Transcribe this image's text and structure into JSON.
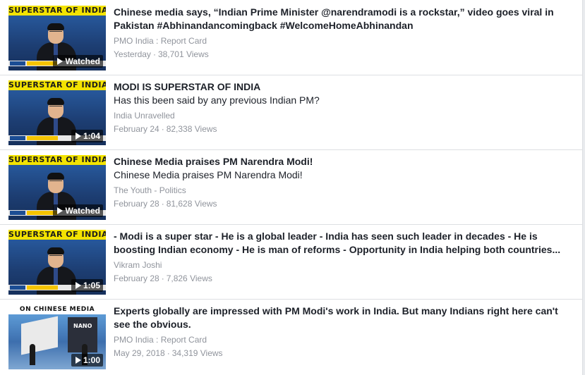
{
  "videos": [
    {
      "title": "Chinese media says, “Indian Prime Minister @narendramodi is a rockstar,” video goes viral in Pakistan #Abhinandancomingback #WelcomeHomeAbhinandan",
      "subtitle": "",
      "channel": "PMO India : Report Card",
      "date": "Yesterday",
      "views": "38,701 Views",
      "badge": "Watched",
      "thumb_banner": "SUPERSTAR OF INDIA"
    },
    {
      "title": "MODI IS SUPERSTAR OF INDIA",
      "subtitle": "Has this been said by any previous Indian PM?",
      "channel": "India Unravelled",
      "date": "February 24",
      "views": "82,338 Views",
      "badge": "1:04",
      "thumb_banner": "SUPERSTAR OF INDIA"
    },
    {
      "title": "Chinese Media praises PM Narendra Modi!",
      "subtitle": "Chinese Media praises PM Narendra Modi!",
      "channel": "The Youth - Politics",
      "date": "February 28",
      "views": "81,628 Views",
      "badge": "Watched",
      "thumb_banner": "SUPERSTAR OF INDIA"
    },
    {
      "title": "- Modi is a super star - He is a global leader - India has seen such leader in decades - He is boosting Indian economy - He is man of reforms - Opportunity in India helping both countries...",
      "subtitle": "",
      "channel": "Vikram Joshi",
      "date": "February 28",
      "views": "7,826 Views",
      "badge": "1:05",
      "thumb_banner": "SUPERSTAR OF INDIA"
    },
    {
      "title": "Experts globally are impressed with PM Modi's work in India. But many Indians right here can't see the obvious.",
      "subtitle": "",
      "channel": "PMO India : Report Card",
      "date": "May 29, 2018",
      "views": "34,319 Views",
      "badge": "1:00",
      "thumb_banner": "ON CHINESE MEDIA"
    }
  ],
  "separator": "·",
  "colors": {
    "title": "#1d2129",
    "meta": "#90949c",
    "banner": "#f3e300",
    "divider": "#dddfe2"
  }
}
